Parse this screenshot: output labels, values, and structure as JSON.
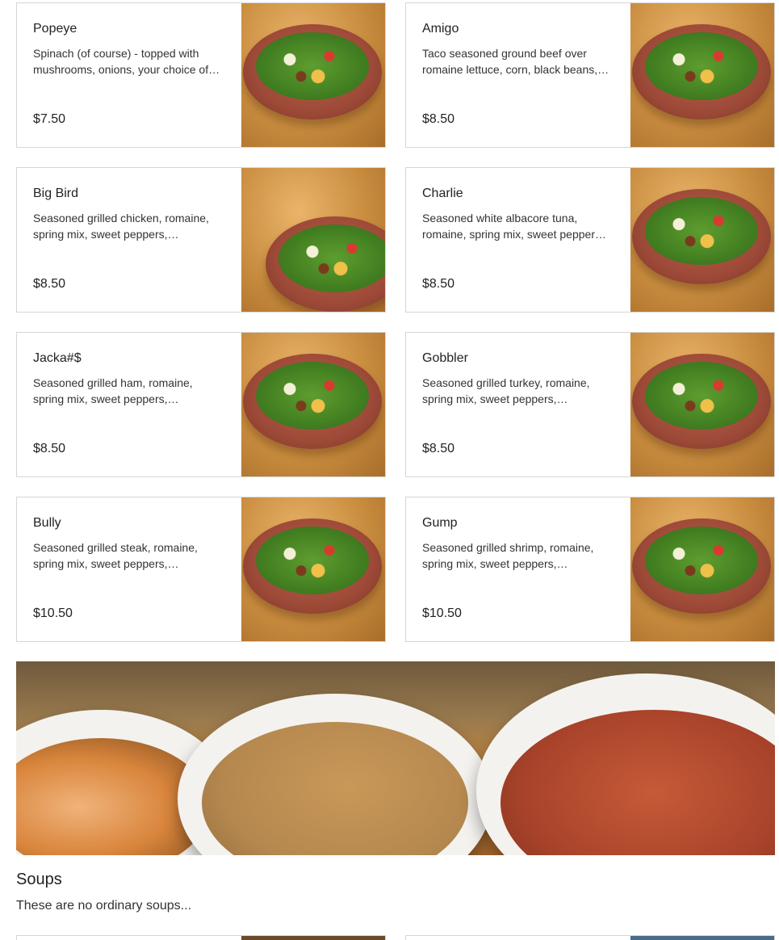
{
  "salads": [
    {
      "name": "Popeye",
      "description": "Spinach (of course) - topped with mushrooms, onions, your choice of…",
      "price": "$7.50",
      "image": "spinach-salad-bowl"
    },
    {
      "name": "Amigo",
      "description": "Taco seasoned ground beef over romaine lettuce, corn, black beans,…",
      "price": "$8.50",
      "image": "taco-salad-bowl"
    },
    {
      "name": "Big Bird",
      "description": "Seasoned grilled chicken, romaine, spring mix, sweet peppers,…",
      "price": "$8.50",
      "image": "chicken-salad-bowl"
    },
    {
      "name": "Charlie",
      "description": "Seasoned white albacore tuna, romaine, spring mix, sweet pepper…",
      "price": "$8.50",
      "image": "tuna-salad-bowl"
    },
    {
      "name": "Jacka#$",
      "description": "Seasoned grilled ham, romaine, spring mix, sweet peppers,…",
      "price": "$8.50",
      "image": "ham-salad-bowl"
    },
    {
      "name": "Gobbler",
      "description": "Seasoned grilled turkey, romaine, spring mix, sweet peppers,…",
      "price": "$8.50",
      "image": "turkey-salad-bowl"
    },
    {
      "name": "Bully",
      "description": "Seasoned grilled steak, romaine, spring mix, sweet peppers,…",
      "price": "$10.50",
      "image": "steak-salad-bowl"
    },
    {
      "name": "Gump",
      "description": "Seasoned grilled shrimp, romaine, spring mix, sweet peppers,…",
      "price": "$10.50",
      "image": "shrimp-salad-bowl"
    }
  ],
  "soups_section": {
    "title": "Soups",
    "subtitle": "These are no ordinary soups...",
    "banner_image": "three-soup-bowls"
  }
}
